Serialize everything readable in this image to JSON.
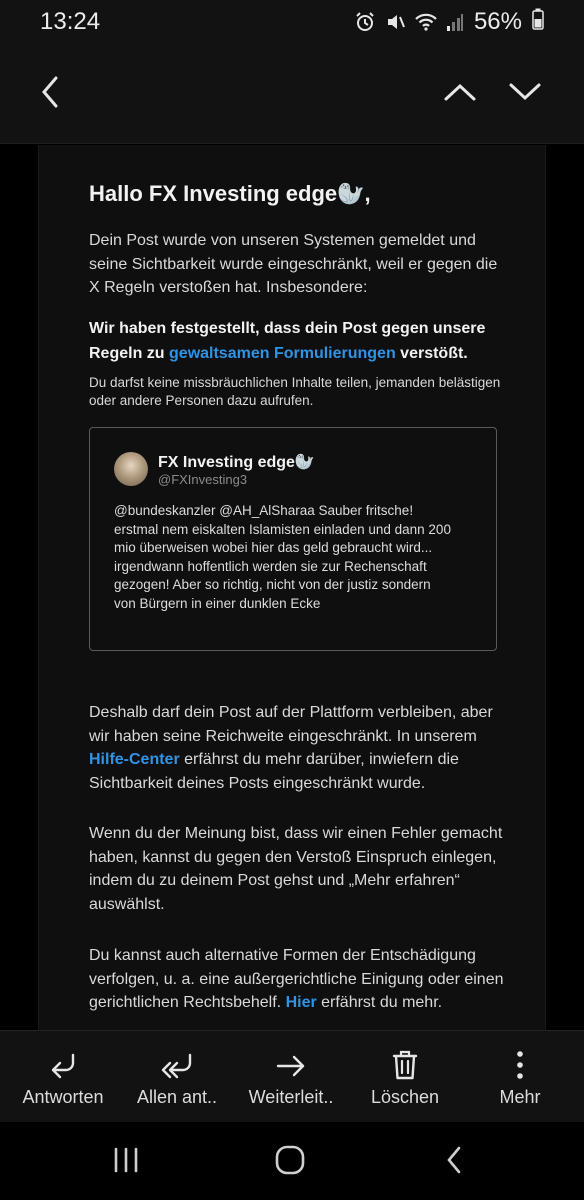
{
  "status_bar": {
    "time": "13:24",
    "battery": "56%",
    "icons": [
      "alarm-icon",
      "mute-icon",
      "wifi-icon",
      "signal-icon",
      "battery-icon"
    ]
  },
  "app_bar": {
    "back_icon": "chevron-left-icon",
    "prev_icon": "chevron-up-icon",
    "next_icon": "chevron-down-icon"
  },
  "email": {
    "greeting": "Hallo FX Investing edge🦭,",
    "intro": "Dein Post wurde von unseren Systemen gemeldet und seine Sichtbarkeit wurde eingeschränkt, weil er gegen die X Regeln verstoßen hat. Insbesondere:",
    "violation_prefix": "Wir haben festgestellt, dass dein Post gegen unsere Regeln zu ",
    "violation_link": "gewaltsamen Formulierungen",
    "violation_suffix": " verstößt.",
    "rule_note": "Du darfst keine missbräuchlichen Inhalte teilen, jemanden belästigen oder andere Personen dazu aufrufen.",
    "tweet": {
      "name": "FX Investing edge🦭",
      "handle": "@FXInvesting3",
      "text": "@bundeskanzler @AH_AlSharaa Sauber fritsche! erstmal nem eiskalten Islamisten einladen und dann 200 mio überweisen wobei hier das geld gebraucht wird... irgendwann hoffentlich werden sie zur Rechenschaft gezogen! Aber so richtig, nicht von der justiz sondern von Bürgern in einer dunklen Ecke"
    },
    "reach_prefix": "Deshalb darf dein Post auf der Plattform verbleiben, aber wir haben seine Reichweite eingeschränkt. In unserem ",
    "reach_link": "Hilfe-Center",
    "reach_suffix": " erfährst du mehr darüber, inwiefern die Sichtbarkeit deines Posts eingeschränkt wurde.",
    "appeal": "Wenn du der Meinung bist, dass wir einen Fehler gemacht haben, kannst du gegen den Verstoß Einspruch einlegen, indem du zu deinem Post gehst und „Mehr erfahren“ auswählst.",
    "remedy_prefix": "Du kannst auch alternative Formen der Entschädigung verfolgen, u. a. eine außergerichtliche Einigung oder einen gerichtlichen Rechtsbehelf. ",
    "remedy_link": "Hier",
    "remedy_suffix": " erfährst du mehr."
  },
  "toolbar": {
    "reply": "Antworten",
    "reply_all": "Allen ant..",
    "forward": "Weiterleit..",
    "delete": "Löschen",
    "more": "Mehr"
  },
  "colors": {
    "background": "#000000",
    "surface": "#121212",
    "link": "#2f93e6",
    "text": "#d9d9d9"
  }
}
